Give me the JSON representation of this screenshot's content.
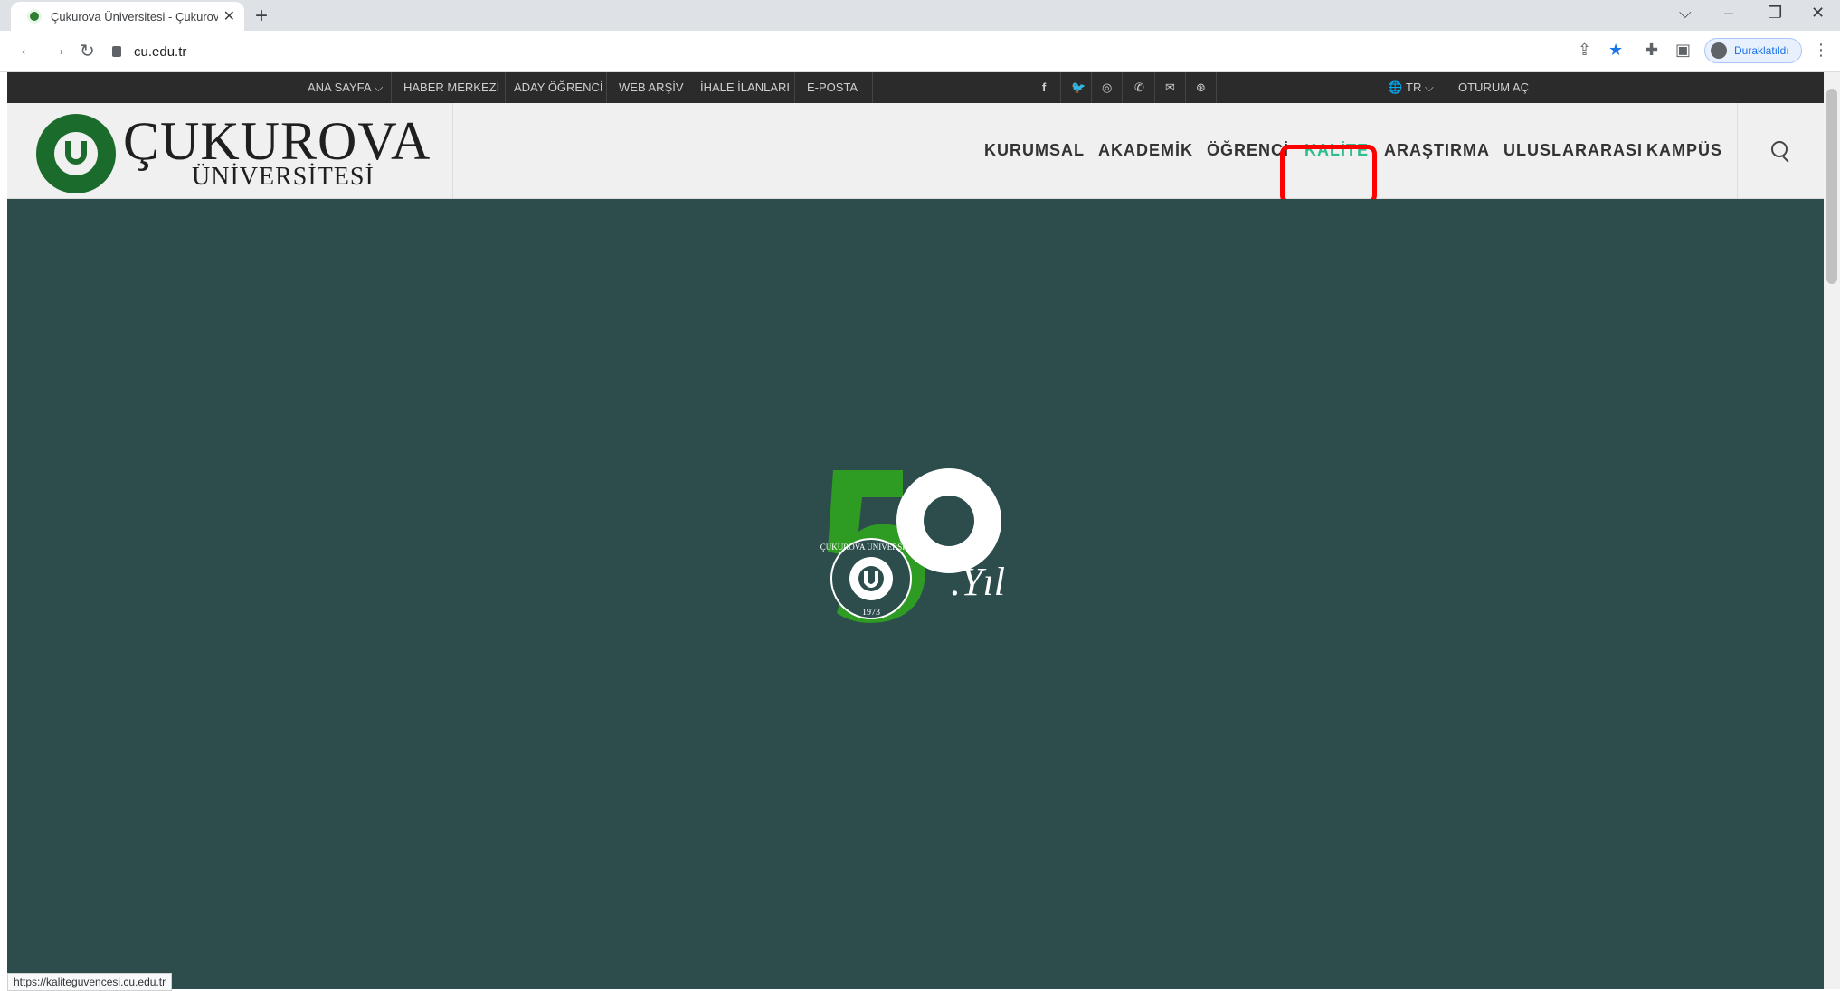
{
  "browser": {
    "tab_title": "Çukurova Üniversitesi - Çukurova",
    "tab_close": "✕",
    "new_tab": "+",
    "url": "cu.edu.tr",
    "profile_label": "Duraklatıldı",
    "window_controls": {
      "collapse": "⌵",
      "minimize": "–",
      "restore": "❐",
      "close": "✕"
    },
    "status_url": "https://kaliteguvencesi.cu.edu.tr"
  },
  "topbar": {
    "links": [
      "ANA SAYFA ⌵",
      "HABER MERKEZİ",
      "ADAY ÖĞRENCİ",
      "WEB ARŞİV",
      "İHALE İLANLARI",
      "E-POSTA"
    ],
    "social_icons": [
      "facebook-icon",
      "twitter-icon",
      "instagram-icon",
      "phone-icon",
      "mail-icon",
      "dribbble-icon"
    ],
    "social_glyphs": [
      "f",
      "🐦",
      "◎",
      "✆",
      "✉",
      "⊛"
    ],
    "language": "TR ⌵",
    "login": "OTURUM AÇ"
  },
  "header": {
    "logo_name": "ÇUKUROVA",
    "logo_sub": "ÜNİVERSİTESİ",
    "nav": [
      "KURUMSAL",
      "AKADEMİK",
      "ÖĞRENCİ",
      "KALİTE",
      "ARAŞTIRMA",
      "ULUSLARARASI",
      "KAMPÜS"
    ],
    "active_nav": "KALİTE",
    "accent_color": "#2ebd8f"
  },
  "hero": {
    "background_color": "#2d4d4d",
    "badge_number": "50",
    "badge_word": ".Yıl",
    "seal_text": "ÇUKUROVA ÜNİVERSİTESİ",
    "seal_year": "1973"
  }
}
